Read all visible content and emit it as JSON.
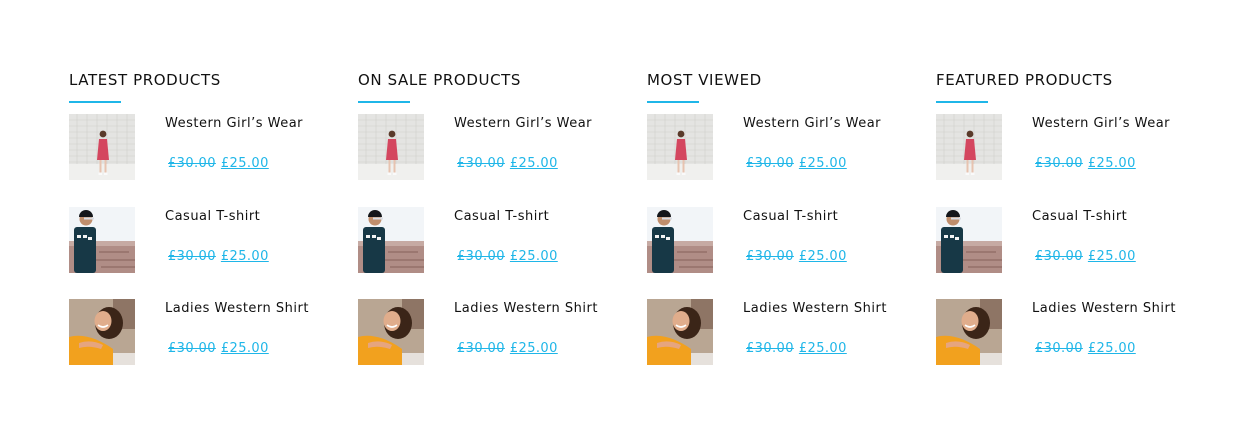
{
  "columns": [
    {
      "title": "LATEST PRODUCTS",
      "products": [
        {
          "name": "Western Girl’s Wear",
          "old_price": "£30.00",
          "new_price": "£25.00",
          "image": "girl-pink-dress"
        },
        {
          "name": "Casual T-shirt",
          "old_price": "£30.00",
          "new_price": "£25.00",
          "image": "man-tshirt-beanie"
        },
        {
          "name": "Ladies Western Shirt",
          "old_price": "£30.00",
          "new_price": "£25.00",
          "image": "woman-yellow-shirt"
        }
      ]
    },
    {
      "title": "ON SALE PRODUCTS",
      "products": [
        {
          "name": "Western Girl’s Wear",
          "old_price": "£30.00",
          "new_price": "£25.00",
          "image": "girl-pink-dress"
        },
        {
          "name": "Casual T-shirt",
          "old_price": "£30.00",
          "new_price": "£25.00",
          "image": "man-tshirt-beanie"
        },
        {
          "name": "Ladies Western Shirt",
          "old_price": "£30.00",
          "new_price": "£25.00",
          "image": "woman-yellow-shirt"
        }
      ]
    },
    {
      "title": "MOST VIEWED",
      "products": [
        {
          "name": "Western Girl’s Wear",
          "old_price": "£30.00",
          "new_price": "£25.00",
          "image": "girl-pink-dress"
        },
        {
          "name": "Casual T-shirt",
          "old_price": "£30.00",
          "new_price": "£25.00",
          "image": "man-tshirt-beanie"
        },
        {
          "name": "Ladies Western Shirt",
          "old_price": "£30.00",
          "new_price": "£25.00",
          "image": "woman-yellow-shirt"
        }
      ]
    },
    {
      "title": "FEATURED PRODUCTS",
      "products": [
        {
          "name": "Western Girl’s Wear",
          "old_price": "£30.00",
          "new_price": "£25.00",
          "image": "girl-pink-dress"
        },
        {
          "name": "Casual T-shirt",
          "old_price": "£30.00",
          "new_price": "£25.00",
          "image": "man-tshirt-beanie"
        },
        {
          "name": "Ladies Western Shirt",
          "old_price": "£30.00",
          "new_price": "£25.00",
          "image": "woman-yellow-shirt"
        }
      ]
    }
  ],
  "colors": {
    "accent": "#1fb6e8",
    "text": "#111111",
    "background": "#ffffff"
  }
}
